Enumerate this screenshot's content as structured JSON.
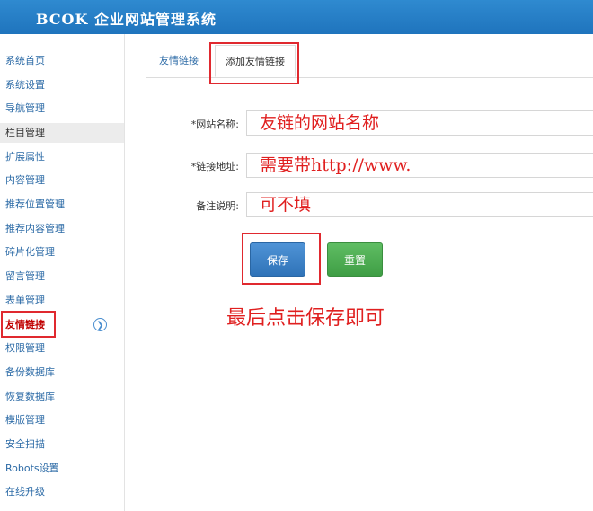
{
  "header": {
    "title": "BCOK 企业网站管理系统"
  },
  "sidebar": {
    "items": [
      {
        "label": "系统首页"
      },
      {
        "label": "系统设置"
      },
      {
        "label": "导航管理"
      },
      {
        "label": "栏目管理"
      },
      {
        "label": "扩展属性"
      },
      {
        "label": "内容管理"
      },
      {
        "label": "推荐位置管理"
      },
      {
        "label": "推荐内容管理"
      },
      {
        "label": "碎片化管理"
      },
      {
        "label": "留言管理"
      },
      {
        "label": "表单管理"
      },
      {
        "label": "友情链接"
      },
      {
        "label": "权限管理"
      },
      {
        "label": "备份数据库"
      },
      {
        "label": "恢复数据库"
      },
      {
        "label": "模版管理"
      },
      {
        "label": "安全扫描"
      },
      {
        "label": "Robots设置"
      },
      {
        "label": "在线升级"
      }
    ],
    "expand_icon": "chevron-right-circle-icon"
  },
  "tabs": [
    {
      "label": "友情链接"
    },
    {
      "label": "添加友情链接"
    }
  ],
  "form": {
    "site_name": {
      "label": "*网站名称:",
      "value": "友链的网站名称"
    },
    "link_url": {
      "label": "*链接地址:",
      "value": "需要带http://www."
    },
    "note": {
      "label": "备注说明:",
      "value": "可不填"
    }
  },
  "buttons": {
    "save": "保存",
    "reset": "重置"
  },
  "annotation": "最后点击保存即可",
  "colors": {
    "header": "#1f74bd",
    "highlight": "#e0292f",
    "annotation": "#e02020",
    "save": "#2f73b8",
    "reset": "#3f9e45"
  }
}
